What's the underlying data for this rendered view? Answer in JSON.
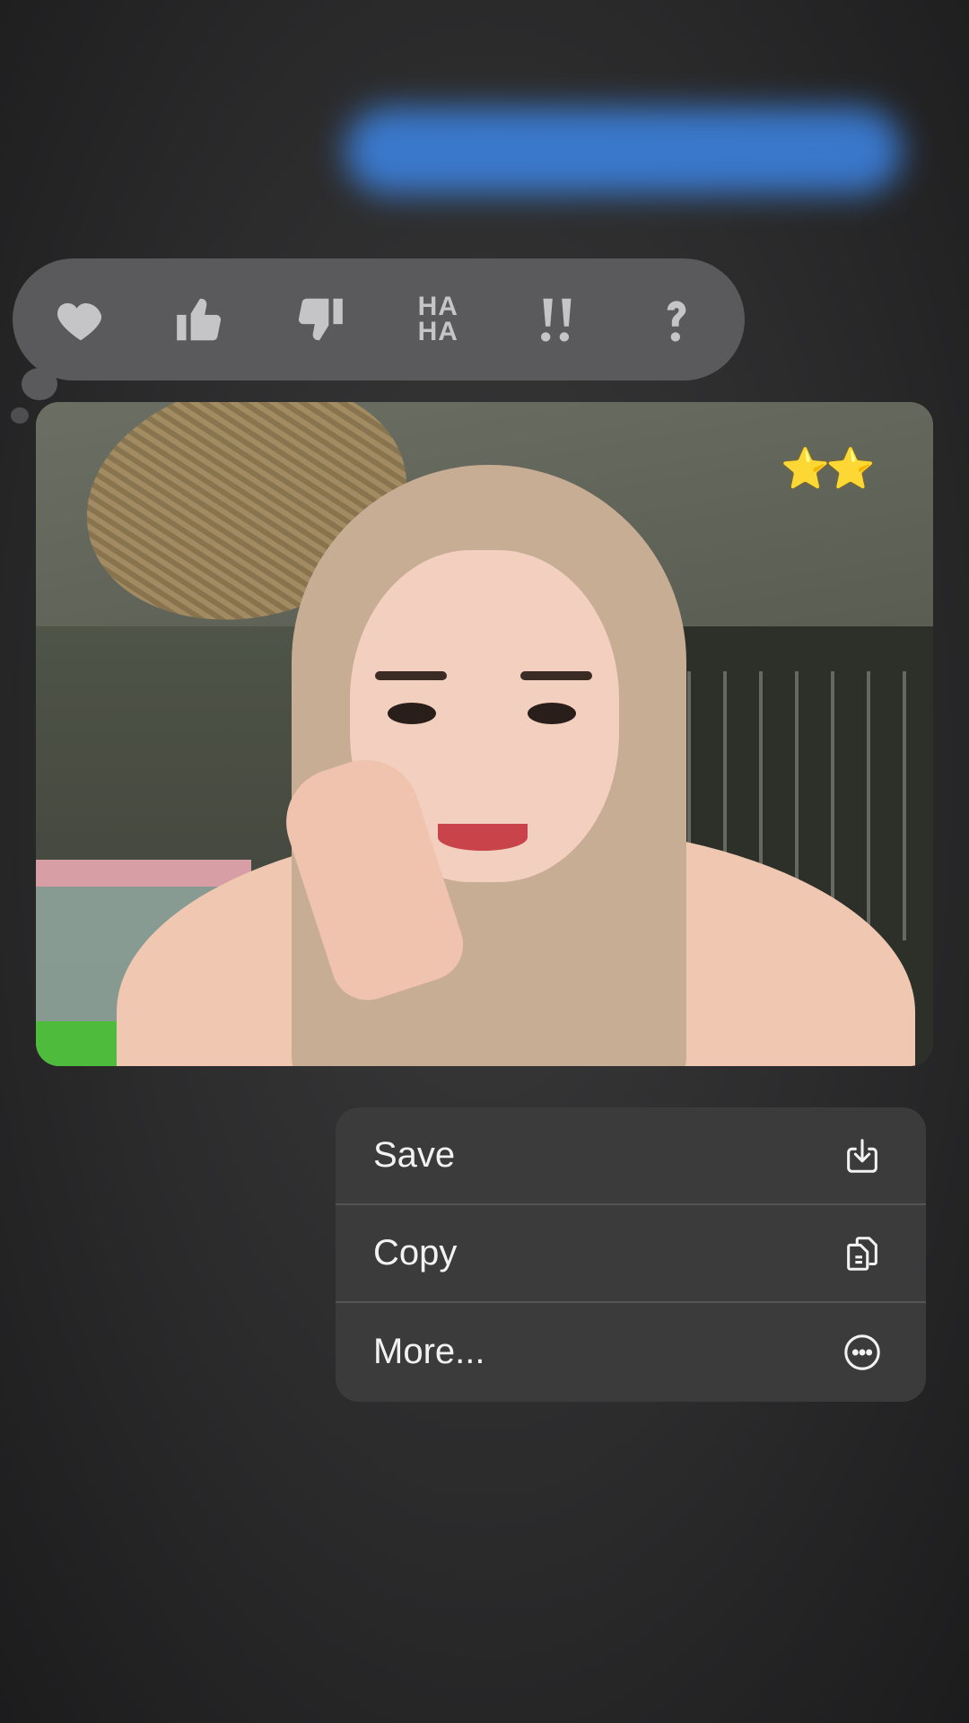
{
  "tapback": {
    "reactions": [
      {
        "icon": "heart-icon"
      },
      {
        "icon": "thumbs-up-icon"
      },
      {
        "icon": "thumbs-down-icon"
      },
      {
        "icon": "haha-icon",
        "text_top": "HA",
        "text_bottom": "HA"
      },
      {
        "icon": "exclamation-icon"
      },
      {
        "icon": "question-icon"
      }
    ]
  },
  "photo": {
    "overlay": "⭐⭐"
  },
  "menu": {
    "items": [
      {
        "label": "Save",
        "icon": "save-icon"
      },
      {
        "label": "Copy",
        "icon": "copy-icon"
      },
      {
        "label": "More...",
        "icon": "more-icon"
      }
    ]
  }
}
